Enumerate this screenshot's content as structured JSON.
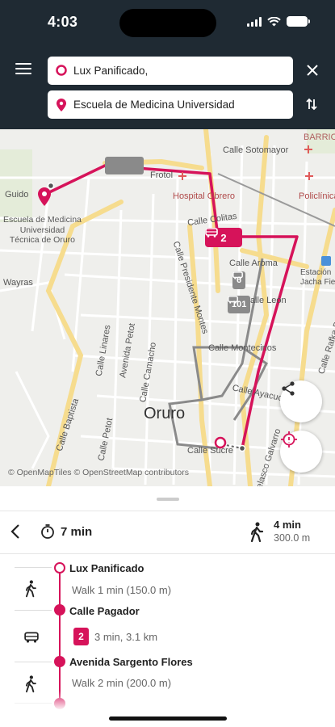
{
  "status_bar": {
    "time": "4:03"
  },
  "search": {
    "from_value": "Lux Panificado,",
    "to_value": "Escuela de Medicina Universidad"
  },
  "map": {
    "labels": {
      "calle_sotomayor": "Calle Sotomayor",
      "barrio": "BARRIO",
      "guido": "Guido",
      "frotol": "Frotol",
      "hospital": "Hospital Obrero",
      "policlinica": "Policlínica",
      "escuela": "Escuela de Medicina\nUniversidad\nTécnica de Oruro",
      "calle_colitas": "Calle Colitas",
      "estacion": "Estación\nJacha Fie",
      "wayras": "Wayras",
      "calle_aroma": "Calle Aroma",
      "calle_presidente_montes": "Calle Presidente Montes",
      "calle_leon": "Calle León",
      "calle_linares": "Calle Linares",
      "avenida_petot": "Avenida Petot",
      "calle_montecinos": "Calle Montecinos",
      "calle_camacho": "Calle Camacho",
      "calle_baptista": "Calle Baptista",
      "calle_petot": "Calle Petot",
      "calle_sucre": "Calle Sucre",
      "calle_ayacucho": "Calle Ayacucho",
      "calle_bakovic": "Calle Rafka Bakovic",
      "velasco_galvarro": "Velasco Galvarro",
      "calle_pagador": "Calle Pagador",
      "city": "Oruro"
    },
    "attribution": "© OpenMapTiles © OpenStreetMap contributors",
    "route_badge": "2",
    "gray_badges": [
      "6",
      "101"
    ]
  },
  "summary": {
    "duration": "7 min",
    "walk_time": "4 min",
    "walk_distance": "300.0 m"
  },
  "itinerary": {
    "stop1": "Lux Panificado",
    "leg1": "Walk 1 min (150.0 m)",
    "stop2": "Calle Pagador",
    "line": "2",
    "leg2": "3 min, 3.1 km",
    "stop3": "Avenida Sargento Flores",
    "leg3": "Walk 2 min (200.0 m)"
  },
  "colors": {
    "accent": "#d6135a",
    "header": "#1f2a33"
  }
}
